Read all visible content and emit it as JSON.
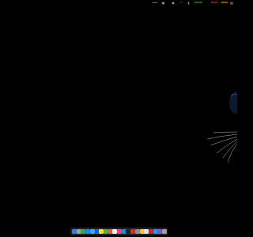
{
  "menubar": {
    "items": [
      {
        "name": "overflow-menu-icon",
        "glyph": "•••",
        "color": "#cccccc"
      },
      {
        "name": "notes-icon",
        "glyph": "▣",
        "color": "#9ccc65"
      },
      {
        "name": "circle-status-icon",
        "glyph": "◉",
        "color": "#cccccc"
      },
      {
        "name": "wifi-icon",
        "glyph": "◠",
        "color": "#cccccc"
      },
      {
        "name": "battery-icon",
        "glyph": "▮",
        "color": "#4caf50"
      },
      {
        "name": "stat-green",
        "text": "▮▮▮▮▮",
        "color": "#4caf50"
      },
      {
        "name": "stat-red",
        "text": "▮▮▮▮",
        "color": "#e53935"
      },
      {
        "name": "stat-amber",
        "text": "▮▮▮▮",
        "color": "#ffb300"
      },
      {
        "name": "control-center-icon",
        "glyph": "▤",
        "color": "#cccccc"
      }
    ]
  },
  "dock": {
    "apps": [
      {
        "name": "finder-icon",
        "color": "#2f7de1"
      },
      {
        "name": "launchpad-icon",
        "color": "#9e9e9e"
      },
      {
        "name": "chrome-icon",
        "color": "#43a047"
      },
      {
        "name": "safari-icon",
        "color": "#1e88e5"
      },
      {
        "name": "mail-icon",
        "color": "#42a5f5"
      },
      {
        "name": "vscode-icon",
        "color": "#1565c0"
      },
      {
        "name": "notes-icon",
        "color": "#fdd835"
      },
      {
        "name": "messages-icon",
        "color": "#4caf50"
      },
      {
        "name": "music-icon",
        "color": "#ef5350"
      },
      {
        "name": "calendar-icon",
        "color": "#eeeeee"
      },
      {
        "name": "photos-icon",
        "color": "#ec407a"
      },
      {
        "name": "app-store-icon",
        "color": "#1e88e5"
      },
      {
        "name": "terminal-icon",
        "color": "#212121"
      },
      {
        "name": "office-icon",
        "color": "#d32f2f"
      },
      {
        "name": "settings-icon",
        "color": "#8e8e8e"
      },
      {
        "name": "stickies-icon",
        "color": "#fbc02d"
      },
      {
        "name": "preview-icon",
        "color": "#e0e0e0"
      },
      {
        "name": "pdf-icon",
        "color": "#c62828"
      },
      {
        "name": "folder-icon",
        "color": "#2196f3"
      },
      {
        "name": "podcasts-icon",
        "color": "#7e57c2"
      },
      {
        "name": "trash-icon",
        "color": "#9e9e9e"
      }
    ]
  }
}
